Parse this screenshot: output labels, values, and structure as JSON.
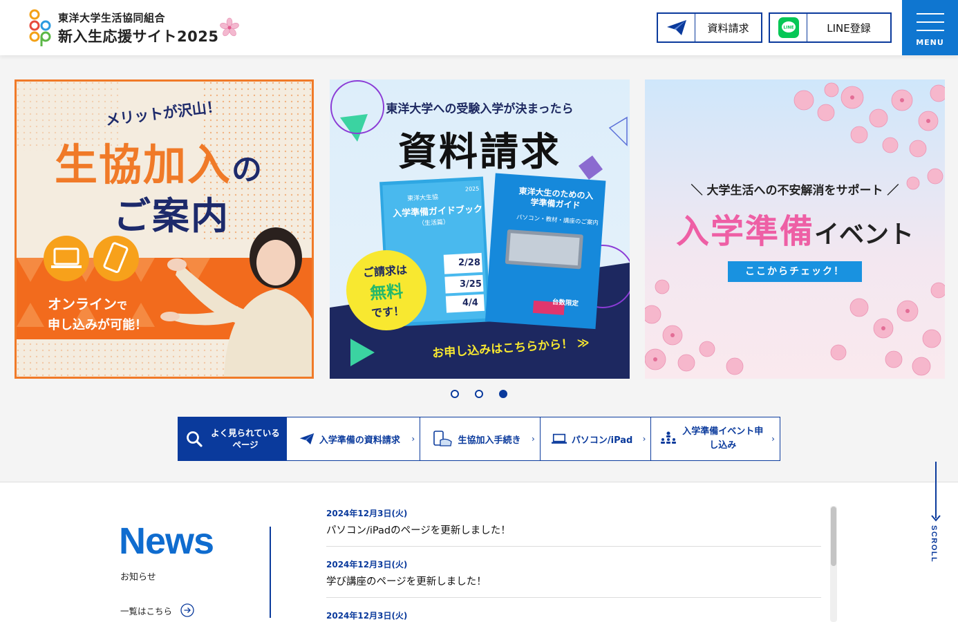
{
  "header": {
    "org_name": "東洋大学生活協同組合",
    "site_name": "新入生応援サイト2025",
    "request_btn": "資料請求",
    "line_btn": "LINE登録",
    "line_icon_text": "LINE",
    "menu_label": "MENU"
  },
  "slides": [
    {
      "tagline": "メリットが沢山！",
      "title_main": "生協加入",
      "title_no": "の",
      "title_sub": "ご案内",
      "online": "オンライン",
      "de": "で",
      "apply": "申し込みが可能！"
    },
    {
      "heading": "東洋大学への受験入学が決まったら",
      "title": "資料請求",
      "book1_title": "入学準備ガイドブック",
      "book1_small": "東洋大生協",
      "book1_year": "2025",
      "book1_sub": "（生活篇）",
      "book2_title": "東洋大生のための入学準備ガイド",
      "book2_sub": "パソコン・教材・講座のご案内",
      "dates": [
        "2/28",
        "3/25",
        "4/4"
      ],
      "badge_line1": "ご請求は",
      "badge_line2": "無料",
      "badge_line3": "です！",
      "cta": "お申し込みはこちらから！ ≫",
      "limited": "台数限定"
    },
    {
      "tagline": "＼ 大学生活への不安解消をサポート ／",
      "title_main": "入学準備",
      "title_sub": "イベント",
      "cta": "ここからチェック！"
    }
  ],
  "carousel_dots": [
    false,
    false,
    true
  ],
  "quick_nav": {
    "head": "よく見られているページ",
    "items": [
      {
        "label": "入学準備の資料請求",
        "icon": "paper-plane-icon"
      },
      {
        "label": "生協加入手続き",
        "icon": "phone-hand-icon"
      },
      {
        "label": "パソコン/iPad",
        "icon": "laptop-icon"
      },
      {
        "label": "入学準備イベント申し込み",
        "icon": "people-icon"
      }
    ]
  },
  "news": {
    "title": "News",
    "subtitle": "お知らせ",
    "more": "一覧はこちら",
    "items": [
      {
        "date": "2024年12月3日(火)",
        "text": "パソコン/iPadのページを更新しました！"
      },
      {
        "date": "2024年12月3日(火)",
        "text": "学び講座のページを更新しました！"
      },
      {
        "date": "2024年12月3日(火)",
        "text": ""
      }
    ]
  },
  "scroll_label": "SCROLL",
  "colors": {
    "brand_blue": "#0a3a9c",
    "accent_blue": "#0f76d0",
    "orange": "#f07a28",
    "pink": "#ee5fa5",
    "line_green": "#06c755"
  }
}
